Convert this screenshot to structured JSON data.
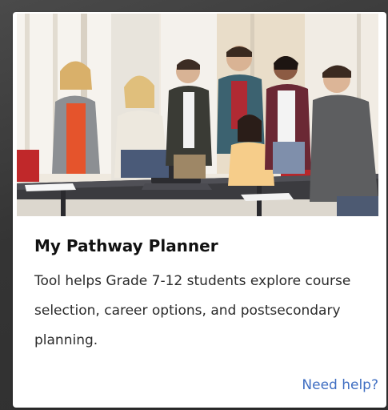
{
  "card": {
    "image_alt": "Students gathered around a table with a teacher",
    "title": "My Pathway Planner",
    "description": "Tool helps Grade 7-12 students explore course selection, career options, and postsecondary planning.",
    "help_link": "Need help?"
  },
  "colors": {
    "page_background": "#3a3a3a",
    "card_background": "#ffffff",
    "title_text": "#111111",
    "body_text": "#2b2b2b",
    "link": "#3f6ec2"
  }
}
